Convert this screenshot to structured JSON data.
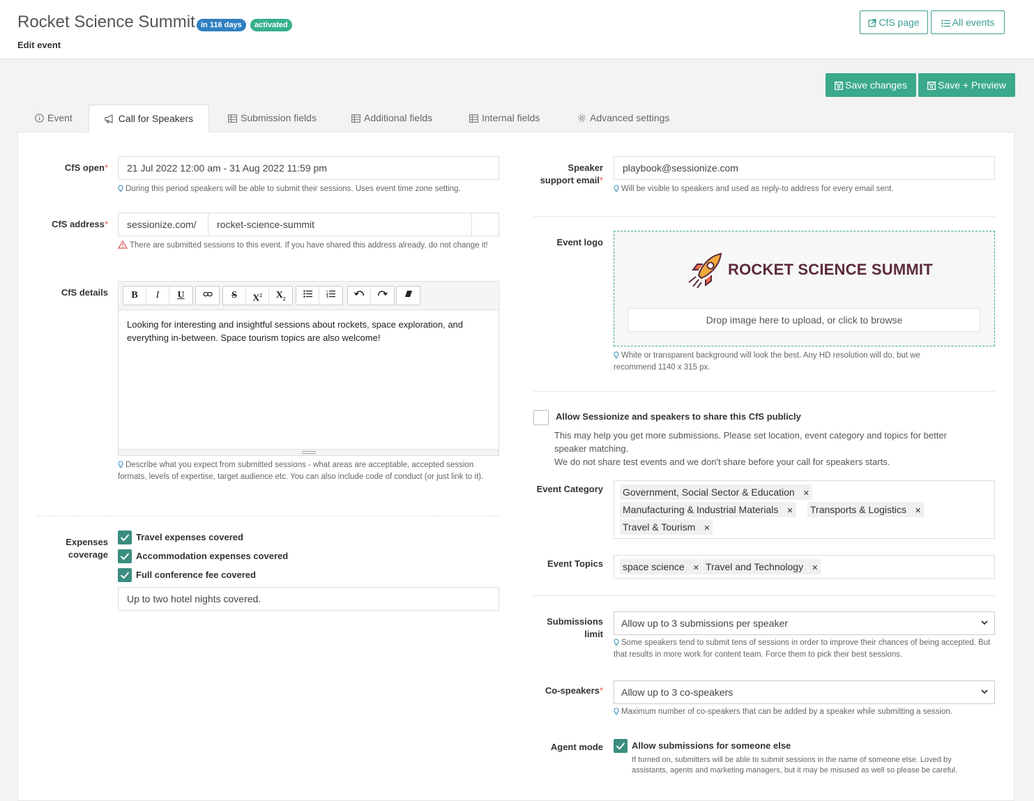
{
  "header": {
    "title": "Rocket Science Summit",
    "badge_days": "in 116 days",
    "badge_status": "activated",
    "subtitle": "Edit event",
    "cfs_page_btn": "CfS page",
    "all_events_btn": "All events"
  },
  "actions": {
    "save": "Save changes",
    "save_preview": "Save + Preview"
  },
  "tabs": [
    {
      "label": "Event",
      "icon": "info-icon"
    },
    {
      "label": "Call for Speakers",
      "icon": "megaphone-icon"
    },
    {
      "label": "Submission fields",
      "icon": "table-icon"
    },
    {
      "label": "Additional fields",
      "icon": "table-icon"
    },
    {
      "label": "Internal fields",
      "icon": "table-icon"
    },
    {
      "label": "Advanced settings",
      "icon": "gear-icon"
    }
  ],
  "cfs_open": {
    "label": "CfS open",
    "value": "21 Jul 2022 12:00 am - 31 Aug 2022 11:59 pm",
    "help": "During this period speakers will be able to submit their sessions. Uses event time zone setting."
  },
  "cfs_address": {
    "label": "CfS address",
    "prefix": "sessionize.com/",
    "value": "rocket-science-summit",
    "warning": "There are submitted sessions to this event. If you have shared this address already, do not change it!"
  },
  "cfs_details": {
    "label": "CfS details",
    "content": "Looking for interesting and insightful sessions about rockets, space exploration, and everything in-between. Space tourism topics are also welcome!",
    "help": "Describe what you expect from submitted sessions - what areas are acceptable, accepted session formats, levels of expertise, target audience etc. You can also include code of conduct (or just link to it)."
  },
  "toolbar": {
    "bold": "B",
    "italic": "I",
    "underline": "U",
    "strike": "S",
    "sup": "X",
    "sub": "X"
  },
  "expenses": {
    "label_line1": "Expenses",
    "label_line2": "coverage",
    "travel": "Travel expenses covered",
    "accommodation": "Accommodation expenses covered",
    "fee": "Full conference fee covered",
    "note": "Up to two hotel nights covered."
  },
  "support_email": {
    "label_line1": "Speaker",
    "label_line2": "support email",
    "value": "playbook@sessionize.com",
    "help": "Will be visible to speakers and used as reply-to address for every email sent."
  },
  "event_logo": {
    "label": "Event logo",
    "logo_text": "ROCKET SCIENCE SUMMIT",
    "drop_text": "Drop image here to upload, or click to browse",
    "help": "White or transparent background will look the best. Any HD resolution will do, but we recommend 1140 x 315 px."
  },
  "share": {
    "label": "Allow Sessionize and speakers to share this CfS publicly",
    "desc1": "This may help you get more submissions. Please set location, event category and topics for better speaker matching.",
    "desc2": "We do not share test events and we don't share before your call for speakers starts."
  },
  "event_category": {
    "label": "Event Category",
    "tags": [
      "Government, Social Sector & Education",
      "Manufacturing & Industrial Materials",
      "Transports & Logistics",
      "Travel & Tourism"
    ]
  },
  "event_topics": {
    "label": "Event Topics",
    "tags": [
      "space science",
      "Travel and Technology"
    ]
  },
  "submissions_limit": {
    "label_line1": "Submissions",
    "label_line2": "limit",
    "value": "Allow up to 3 submissions per speaker",
    "help": "Some speakers tend to submit tens of sessions in order to improve their chances of being accepted. But that results in more work for content team. Force them to pick their best sessions."
  },
  "co_speakers": {
    "label": "Co-speakers",
    "value": "Allow up to 3 co-speakers",
    "help": "Maximum number of co-speakers that can be added by a speaker while submitting a session."
  },
  "agent_mode": {
    "label": "Agent mode",
    "check_label": "Allow submissions for someone else",
    "help": "If turned on, submitters will be able to submit sessions in the name of someone else. Loved by assistants, agents and marketing managers, but it may be misused as well so please be careful."
  },
  "colors": {
    "accent": "#3aa98c",
    "checkbox": "#3a8d80",
    "badge_blue": "#2f7fc1",
    "required": "#d9534f"
  }
}
